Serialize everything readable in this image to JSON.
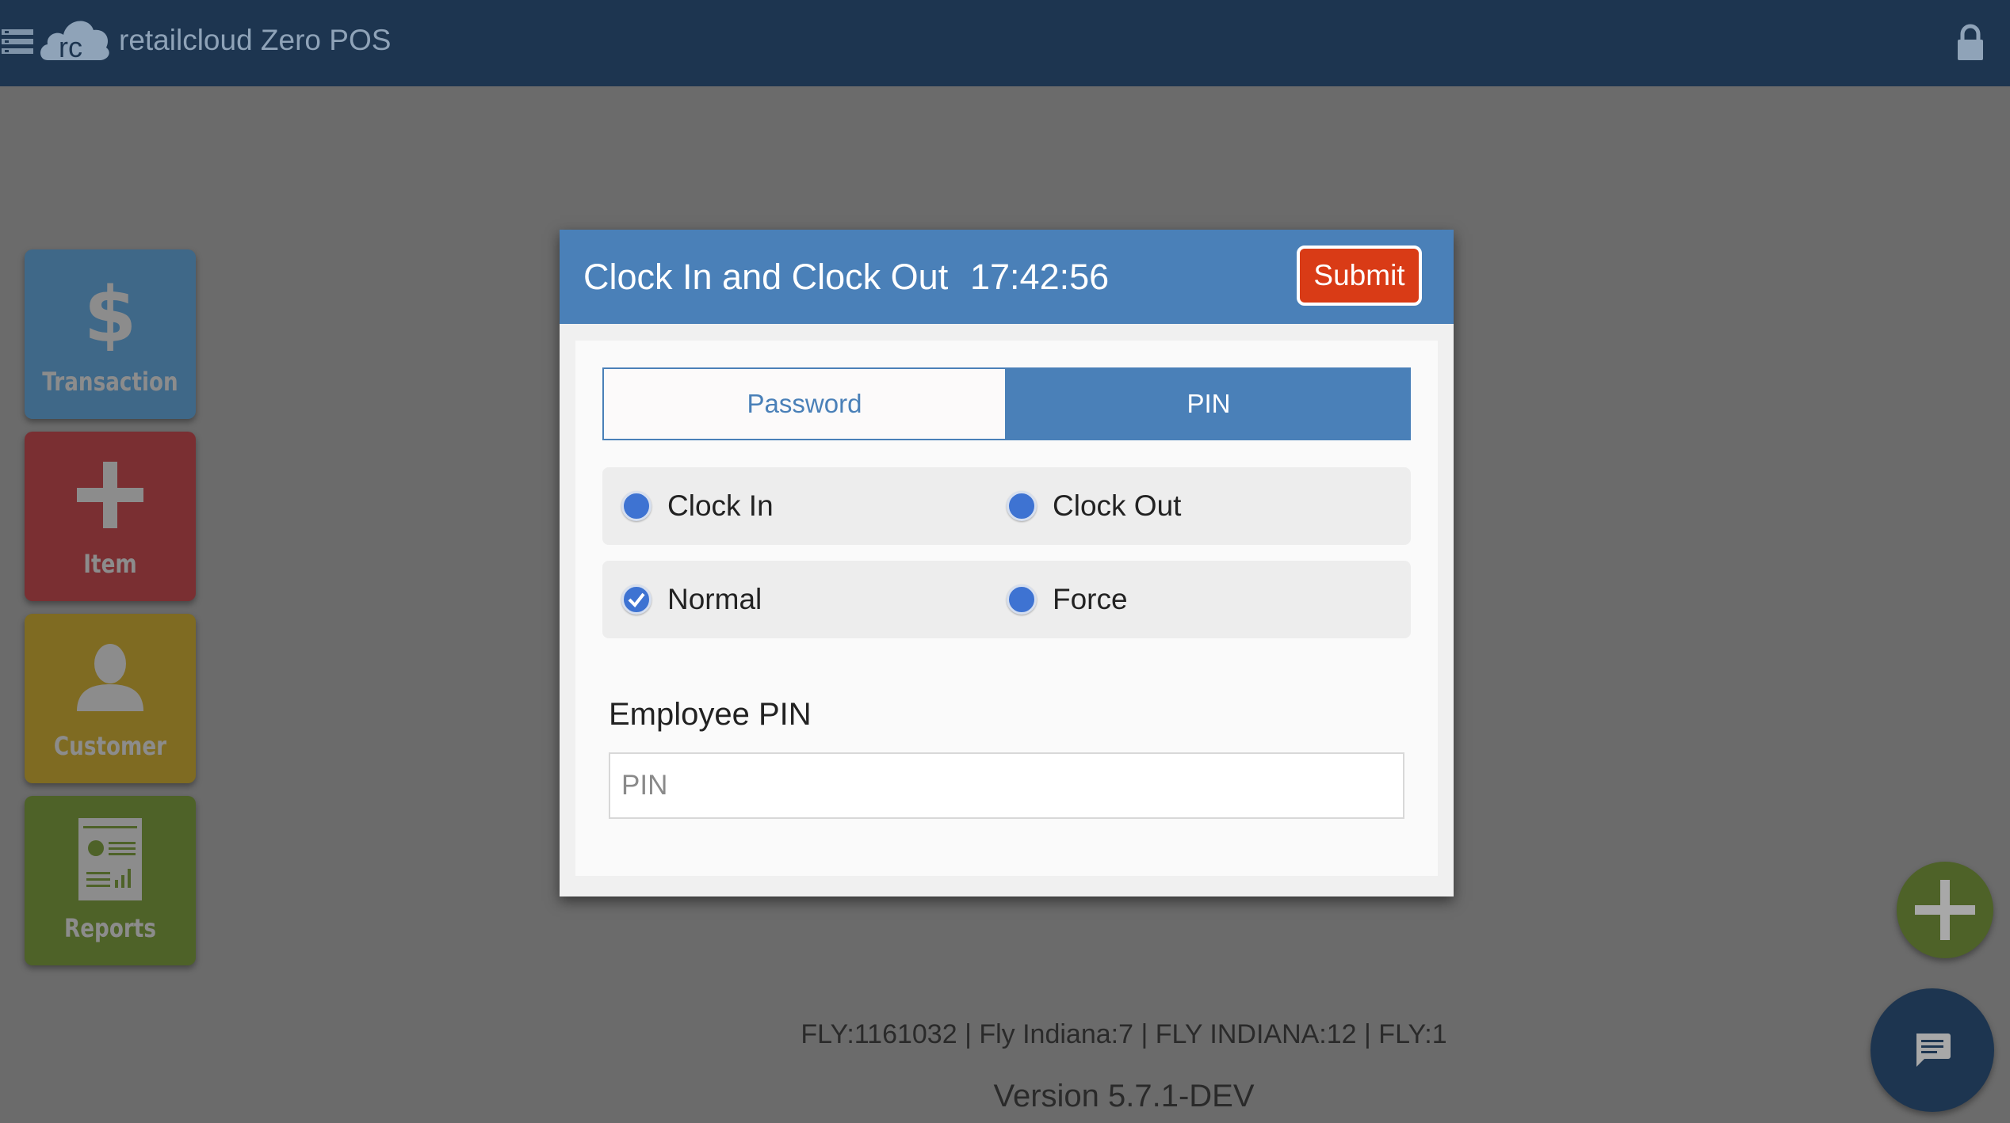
{
  "app": {
    "title": "retailcloud Zero POS",
    "logo_text": "rc"
  },
  "tiles": [
    {
      "label": "Transaction",
      "icon": "dollar-icon"
    },
    {
      "label": "Item",
      "icon": "plus-icon"
    },
    {
      "label": "Customer",
      "icon": "person-icon"
    },
    {
      "label": "Reports",
      "icon": "report-icon"
    }
  ],
  "dialog": {
    "title": "Clock In and Clock Out",
    "time": "17:42:56",
    "submit_label": "Submit",
    "tabs": [
      {
        "label": "Password",
        "selected": false
      },
      {
        "label": "PIN",
        "selected": true
      }
    ],
    "action_options": [
      {
        "label": "Clock In",
        "checked": false
      },
      {
        "label": "Clock Out",
        "checked": false
      }
    ],
    "mode_options": [
      {
        "label": "Normal",
        "checked": true
      },
      {
        "label": "Force",
        "checked": false
      }
    ],
    "pin_field": {
      "label": "Employee PIN",
      "value": "",
      "placeholder": "PIN"
    }
  },
  "footer": {
    "store_info": "FLY:1161032 | Fly Indiana:7 | FLY INDIANA:12 | FLY:1",
    "version": "Version 5.7.1-DEV"
  },
  "colors": {
    "topbar": "#1d3550",
    "dialog_header": "#4a80b8",
    "submit": "#d93b16",
    "transaction_tile": "#3f6888",
    "item_tile": "#7a2f32",
    "customer_tile": "#7f6b22",
    "reports_tile": "#4e6228"
  }
}
